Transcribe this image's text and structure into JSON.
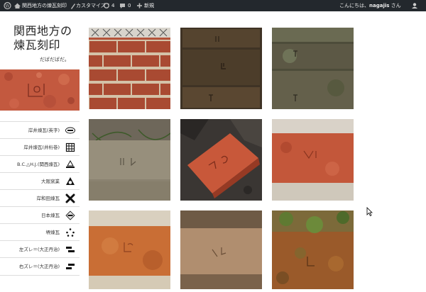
{
  "admin_bar": {
    "site_name": "関西地方の煉瓦刻印",
    "customize_label": "カスタマイズ",
    "updates_count": "4",
    "comments_count": "0",
    "new_label": "新規",
    "greeting": "こんにちは、",
    "username": "nagajis",
    "greeting_suffix": " さん"
  },
  "site": {
    "title_line1": "関西地方の",
    "title_line2": "煉瓦刻印",
    "tagline": "だばだばだ。"
  },
  "menu": {
    "items": [
      {
        "label": "岸井煉瓦(英字)",
        "icon": "kishii-english-mark"
      },
      {
        "label": "岸井煉瓦(井桁巻)",
        "icon": "kishii-igeta-mark"
      },
      {
        "label": "B.C.△H.J.(関西煉瓦)",
        "icon": "kansai-bchj-mark"
      },
      {
        "label": "大阪窯業",
        "icon": "osaka-yogyo-mark"
      },
      {
        "label": "岸和田煉瓦",
        "icon": "kishiwada-cross-mark"
      },
      {
        "label": "日本煉瓦",
        "icon": "nihon-renga-mark"
      },
      {
        "label": "堺煉瓦",
        "icon": "sakai-mark"
      },
      {
        "label": "左ズレ＝(大正丹治)",
        "icon": "left-shift-mark"
      },
      {
        "label": "右ズレ＝(大正丹治)",
        "icon": "right-shift-mark"
      }
    ]
  },
  "gallery": {
    "items": [
      {
        "name": "brick-wall-vent",
        "color": "#9c4a36"
      },
      {
        "name": "dark-brick-stack",
        "color": "#4a3a2a"
      },
      {
        "name": "mossy-brick-stack",
        "color": "#5c5a44"
      },
      {
        "name": "grey-brick-grass",
        "color": "#8d8470"
      },
      {
        "name": "red-brick-rubble",
        "color": "#b4472e"
      },
      {
        "name": "red-brick-closeup",
        "color": "#c0573b"
      },
      {
        "name": "orange-brick-pavement",
        "color": "#c46a32"
      },
      {
        "name": "tan-brick-surface",
        "color": "#a98668"
      },
      {
        "name": "moss-covered-brick",
        "color": "#9a5a2a"
      }
    ]
  }
}
